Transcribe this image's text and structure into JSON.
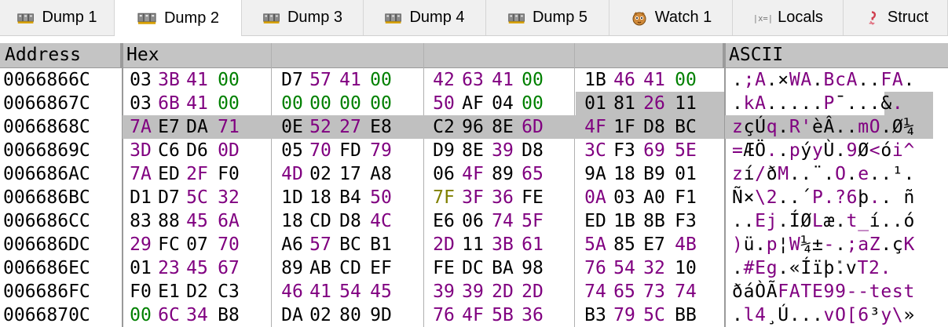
{
  "tabs": [
    {
      "label": "Dump 1",
      "icon": "dump-icon",
      "active": false
    },
    {
      "label": "Dump 2",
      "icon": "dump-icon",
      "active": true
    },
    {
      "label": "Dump 3",
      "icon": "dump-icon",
      "active": false
    },
    {
      "label": "Dump 4",
      "icon": "dump-icon",
      "active": false
    },
    {
      "label": "Dump 5",
      "icon": "dump-icon",
      "active": false
    },
    {
      "label": "Watch 1",
      "icon": "watch-icon",
      "active": false
    },
    {
      "label": "Locals",
      "icon": "locals-icon",
      "active": false
    },
    {
      "label": "Struct",
      "icon": "struct-icon",
      "active": false
    }
  ],
  "columns": {
    "address": "Address",
    "hex": "Hex",
    "ascii": "ASCII"
  },
  "colors": {
    "zero": "#008000",
    "purple": "#800080",
    "olive": "#808000",
    "black": "#000000",
    "highlight": "#c0c0c0"
  },
  "selection": {
    "start_address": "00668678",
    "end_address": "00668697"
  },
  "rows": [
    {
      "address": "0066866C",
      "bytes": [
        "03",
        "3B",
        "41",
        "00",
        "D7",
        "57",
        "41",
        "00",
        "42",
        "63",
        "41",
        "00",
        "1B",
        "46",
        "41",
        "00"
      ],
      "colors": [
        "k",
        "p",
        "p",
        "g",
        "k",
        "p",
        "p",
        "g",
        "p",
        "p",
        "p",
        "g",
        "k",
        "p",
        "p",
        "g"
      ],
      "ascii": ".;A.×WA.BcA..FA."
    },
    {
      "address": "0066867C",
      "bytes": [
        "03",
        "6B",
        "41",
        "00",
        "00",
        "00",
        "00",
        "00",
        "50",
        "AF",
        "04",
        "00",
        "01",
        "81",
        "26",
        "11"
      ],
      "colors": [
        "k",
        "p",
        "p",
        "g",
        "g",
        "g",
        "g",
        "g",
        "p",
        "k",
        "k",
        "g",
        "k",
        "k",
        "p",
        "k"
      ],
      "ascii": ".kA.....P¯...&."
    },
    {
      "address": "0066868C",
      "bytes": [
        "7A",
        "E7",
        "DA",
        "71",
        "0E",
        "52",
        "27",
        "E8",
        "C2",
        "96",
        "8E",
        "6D",
        "4F",
        "1F",
        "D8",
        "BC"
      ],
      "colors": [
        "p",
        "k",
        "k",
        "p",
        "k",
        "p",
        "p",
        "k",
        "k",
        "k",
        "k",
        "p",
        "p",
        "k",
        "k",
        "k"
      ],
      "ascii": "zçÚq.R'èÂ..mO.Ø¼"
    },
    {
      "address": "0066869C",
      "bytes": [
        "3D",
        "C6",
        "D6",
        "0D",
        "05",
        "70",
        "FD",
        "79",
        "D9",
        "8E",
        "39",
        "D8",
        "3C",
        "F3",
        "69",
        "5E"
      ],
      "colors": [
        "p",
        "k",
        "k",
        "p",
        "k",
        "p",
        "k",
        "p",
        "k",
        "k",
        "p",
        "k",
        "p",
        "k",
        "p",
        "p"
      ],
      "ascii": "=ÆÖ..pýyÙ.9Ø<ói^"
    },
    {
      "address": "006686AC",
      "bytes": [
        "7A",
        "ED",
        "2F",
        "F0",
        "4D",
        "02",
        "17",
        "A8",
        "06",
        "4F",
        "89",
        "65",
        "9A",
        "18",
        "B9",
        "01"
      ],
      "colors": [
        "p",
        "k",
        "p",
        "k",
        "p",
        "k",
        "k",
        "k",
        "k",
        "p",
        "k",
        "p",
        "k",
        "k",
        "k",
        "k"
      ],
      "ascii": "zí/ðM..¨.O.e..¹."
    },
    {
      "address": "006686BC",
      "bytes": [
        "D1",
        "D7",
        "5C",
        "32",
        "1D",
        "18",
        "B4",
        "50",
        "7F",
        "3F",
        "36",
        "FE",
        "0A",
        "03",
        "A0",
        "F1"
      ],
      "colors": [
        "k",
        "k",
        "p",
        "p",
        "k",
        "k",
        "k",
        "p",
        "o",
        "p",
        "p",
        "k",
        "p",
        "k",
        "k",
        "k"
      ],
      "ascii": "Ñ×\\2..´P.?6þ.. ñ"
    },
    {
      "address": "006686CC",
      "bytes": [
        "83",
        "88",
        "45",
        "6A",
        "18",
        "CD",
        "D8",
        "4C",
        "E6",
        "06",
        "74",
        "5F",
        "ED",
        "1B",
        "8B",
        "F3"
      ],
      "colors": [
        "k",
        "k",
        "p",
        "p",
        "k",
        "k",
        "k",
        "p",
        "k",
        "k",
        "p",
        "p",
        "k",
        "k",
        "k",
        "k"
      ],
      "ascii": "..Ej.ÍØLæ.t_í..ó"
    },
    {
      "address": "006686DC",
      "bytes": [
        "29",
        "FC",
        "07",
        "70",
        "A6",
        "57",
        "BC",
        "B1",
        "2D",
        "11",
        "3B",
        "61",
        "5A",
        "85",
        "E7",
        "4B"
      ],
      "colors": [
        "p",
        "k",
        "k",
        "p",
        "k",
        "p",
        "k",
        "k",
        "p",
        "k",
        "p",
        "p",
        "p",
        "k",
        "k",
        "p"
      ],
      "ascii": ")ü.p¦W¼±-.;aZ.çK"
    },
    {
      "address": "006686EC",
      "bytes": [
        "01",
        "23",
        "45",
        "67",
        "89",
        "AB",
        "CD",
        "EF",
        "FE",
        "DC",
        "BA",
        "98",
        "76",
        "54",
        "32",
        "10"
      ],
      "colors": [
        "k",
        "p",
        "p",
        "p",
        "k",
        "k",
        "k",
        "k",
        "k",
        "k",
        "k",
        "k",
        "p",
        "p",
        "p",
        "k"
      ],
      "ascii": ".#Eg.«Íïþܺ.vT2."
    },
    {
      "address": "006686FC",
      "bytes": [
        "F0",
        "E1",
        "D2",
        "C3",
        "46",
        "41",
        "54",
        "45",
        "39",
        "39",
        "2D",
        "2D",
        "74",
        "65",
        "73",
        "74"
      ],
      "colors": [
        "k",
        "k",
        "k",
        "k",
        "p",
        "p",
        "p",
        "p",
        "p",
        "p",
        "p",
        "p",
        "p",
        "p",
        "p",
        "p"
      ],
      "ascii": "ðáÒÃFATE99--test"
    },
    {
      "address": "0066870C",
      "bytes": [
        "00",
        "6C",
        "34",
        "B8",
        "DA",
        "02",
        "80",
        "9D",
        "76",
        "4F",
        "5B",
        "36",
        "B3",
        "79",
        "5C",
        "BB"
      ],
      "colors": [
        "g",
        "p",
        "p",
        "k",
        "k",
        "k",
        "k",
        "k",
        "p",
        "p",
        "p",
        "p",
        "k",
        "p",
        "p",
        "k"
      ],
      "ascii": ".l4¸Ú...vO[6³y\\»"
    }
  ]
}
